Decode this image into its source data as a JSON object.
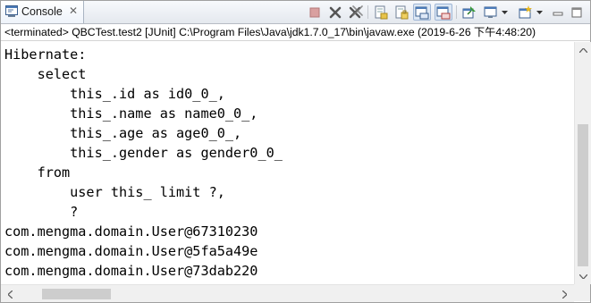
{
  "tab": {
    "label": "Console",
    "close": "✕"
  },
  "toolbar": {
    "icons": [
      "terminate-icon",
      "remove-launch-icon",
      "remove-all-terminated-icon",
      "clear-console-icon",
      "scroll-lock-icon",
      "show-stdout-icon",
      "show-stderr-icon",
      "pin-console-icon",
      "display-selected-console-icon",
      "open-console-icon",
      "minimize-icon",
      "maximize-icon"
    ]
  },
  "status": "<terminated> QBCTest.test2 [JUnit] C:\\Program Files\\Java\\jdk1.7.0_17\\bin\\javaw.exe (2019-6-26 下午4:48:20)",
  "console": {
    "lines": [
      "Hibernate:",
      "    select",
      "        this_.id as id0_0_,",
      "        this_.name as name0_0_,",
      "        this_.age as age0_0_,",
      "        this_.gender as gender0_0_",
      "    from",
      "        user this_ limit ?,",
      "        ?",
      "com.mengma.domain.User@67310230",
      "com.mengma.domain.User@5fa5a49e",
      "com.mengma.domain.User@73dab220"
    ]
  }
}
